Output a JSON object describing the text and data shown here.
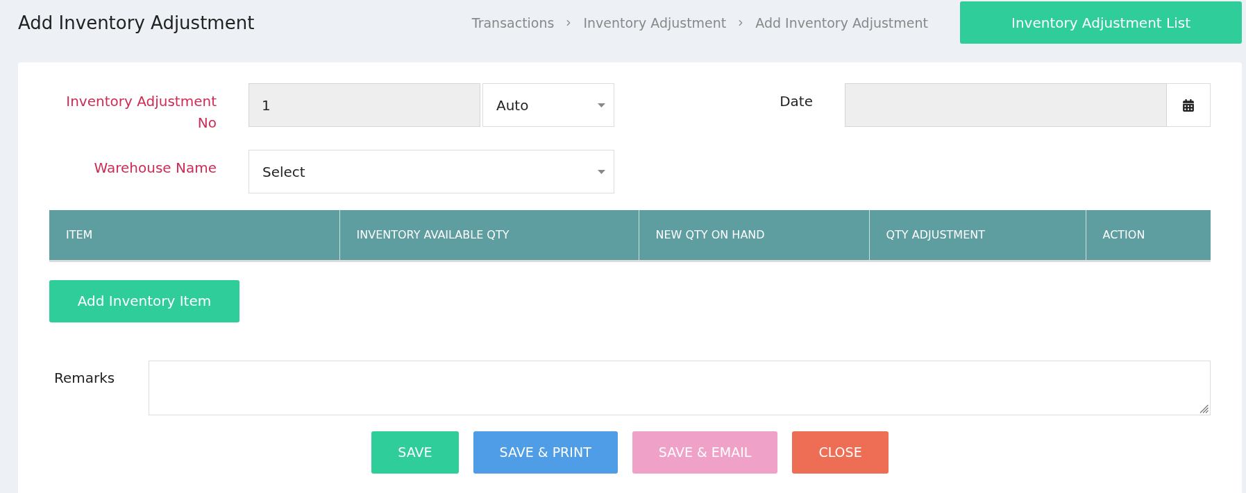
{
  "header": {
    "title": "Add Inventory Adjustment",
    "breadcrumb": [
      "Transactions",
      "Inventory Adjustment",
      "Add Inventory Adjustment"
    ],
    "list_button": "Inventory Adjustment List"
  },
  "form": {
    "adjustment_no": {
      "label": "Inventory Adjustment No",
      "required": true,
      "value": "1",
      "readonly": true,
      "mode": "Auto"
    },
    "date": {
      "label": "Date",
      "required": false,
      "readonly": true
    },
    "warehouse": {
      "label": "Warehouse Name",
      "required": true,
      "value": "Select"
    }
  },
  "table": {
    "columns": [
      "ITEM",
      "INVENTORY AVAILABLE QTY",
      "NEW QTY ON HAND",
      "QTY ADJUSTMENT",
      "ACTION"
    ]
  },
  "add_item_button": "Add Inventory Item",
  "remarks": {
    "label": "Remarks"
  },
  "actions": [
    {
      "label": "SAVE",
      "color": "#2ecd99"
    },
    {
      "label": "SAVE & PRINT",
      "color": "#4f9de6"
    },
    {
      "label": "SAVE & EMAIL",
      "color": "#f0a1c8"
    },
    {
      "label": "CLOSE",
      "color": "#ee6e55"
    }
  ]
}
